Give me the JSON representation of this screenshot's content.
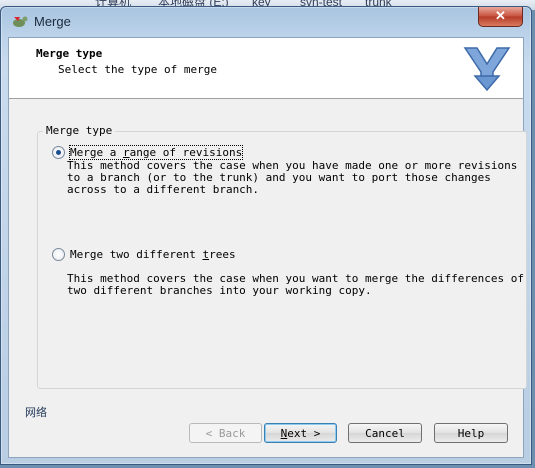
{
  "background": {
    "explorer_path_fragments": [
      "计算机",
      "本地磁盘 (E:)",
      "key",
      "svn-test",
      "trunk"
    ],
    "side_label": "网络"
  },
  "window": {
    "title": "Merge",
    "close_glyph": "✕"
  },
  "header": {
    "title": "Merge type",
    "subtitle": "Select the type of merge"
  },
  "group": {
    "legend": "Merge type",
    "options": [
      {
        "label_before": "Merge a ",
        "label_hotkey": "r",
        "label_after": "ange of revisions",
        "checked": true,
        "description": "This method covers the case when you have made one or more revisions\nto a branch (or to the trunk) and you want to port those changes\nacross to a different branch."
      },
      {
        "label_before": "Merge two different ",
        "label_hotkey": "t",
        "label_after": "rees",
        "checked": false,
        "description": "This method covers the case when you want to merge the differences of\ntwo different branches into your working copy."
      }
    ]
  },
  "buttons": {
    "back": {
      "arrow": "<",
      "label": "Back",
      "enabled": false
    },
    "next": {
      "label_hotkey": "N",
      "label_rest": "ext",
      "arrow": ">",
      "is_default": true
    },
    "cancel": "Cancel",
    "help": "Help"
  },
  "colors": {
    "window_frame": "#bdd3ea",
    "close_button": "#c8503c",
    "logo": "#5a86c4"
  },
  "icons": {
    "app": "tortoise-merge-icon",
    "logo": "merge-arrows-icon",
    "close": "close-icon"
  }
}
